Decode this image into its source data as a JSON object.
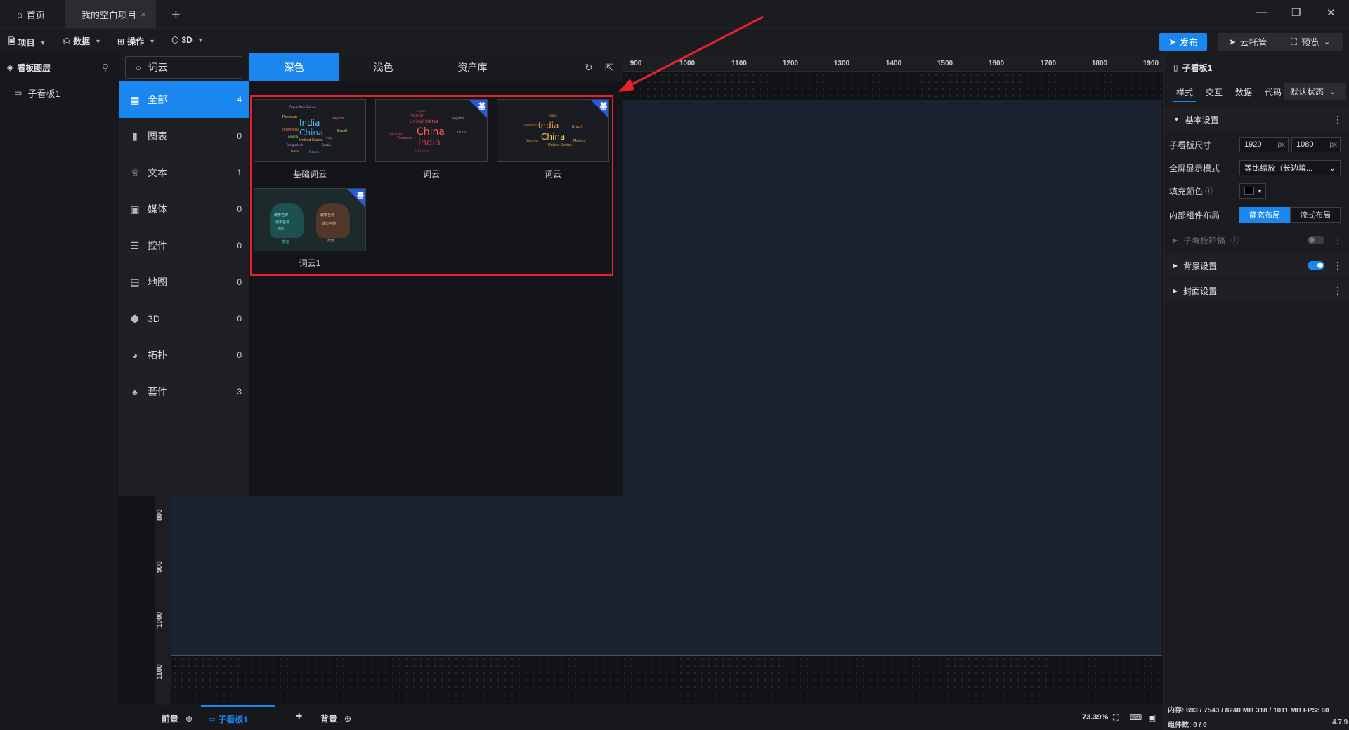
{
  "tabs": {
    "home_label": "首页",
    "project_label": "我的空白项目",
    "close_glyph": "×",
    "add_glyph": "+"
  },
  "window_controls": {
    "minimize": "—",
    "restore": "❐",
    "close": "✕"
  },
  "toolbar": {
    "menus": [
      {
        "label": "项目",
        "icon": "file-icon"
      },
      {
        "label": "数据",
        "icon": "database-icon"
      },
      {
        "label": "操作",
        "icon": "grid-icon"
      },
      {
        "label": "3D",
        "icon": "cube-icon"
      }
    ],
    "publish_label": "发布",
    "cloud_label": "云托管",
    "preview_label": "预览"
  },
  "layers": {
    "title": "看板图层",
    "items": [
      {
        "label": "子看板1"
      }
    ]
  },
  "component_panel": {
    "search_value": "词云",
    "categories": [
      {
        "label": "全部",
        "count": "4",
        "icon": "grid-icon"
      },
      {
        "label": "图表",
        "count": "0",
        "icon": "bar-chart-icon"
      },
      {
        "label": "文本",
        "count": "1",
        "icon": "text-icon"
      },
      {
        "label": "媒体",
        "count": "0",
        "icon": "media-icon"
      },
      {
        "label": "控件",
        "count": "0",
        "icon": "control-icon"
      },
      {
        "label": "地图",
        "count": "0",
        "icon": "map-icon"
      },
      {
        "label": "3D",
        "count": "0",
        "icon": "cube-icon"
      },
      {
        "label": "拓扑",
        "count": "0",
        "icon": "topology-icon"
      },
      {
        "label": "套件",
        "count": "3",
        "icon": "kit-icon"
      }
    ],
    "theme_tabs": [
      {
        "label": "深色"
      },
      {
        "label": "浅色"
      },
      {
        "label": "资产库"
      }
    ],
    "cards": [
      {
        "label": "基础词云",
        "badge": ""
      },
      {
        "label": "词云",
        "badge": "基"
      },
      {
        "label": "词云",
        "badge": "基"
      },
      {
        "label": "词云1",
        "badge": "基"
      }
    ],
    "thumb_words": {
      "a": [
        "Papua New Guinea",
        "India",
        "China",
        "United States",
        "Indonesia",
        "Brazil",
        "Pakistan",
        "Nigeria",
        "Bangladesh",
        "Russia",
        "Japan",
        "Mexico",
        "Algeria",
        "Iraq"
      ],
      "b": [
        "Pakistan",
        "United States",
        "China",
        "India",
        "Nigeria",
        "Brazil",
        "Canada",
        "Tanzania",
        "Ukraine",
        "Algeria"
      ],
      "c": [
        "India",
        "China",
        "United States",
        "Pakistan",
        "Brazil",
        "Nigeria",
        "Mexico",
        "Japan"
      ],
      "d_left": [
        "城市名称",
        "城市名称",
        "数据",
        "数值"
      ],
      "d_right": [
        "城市名称",
        "城市名称",
        "数值"
      ]
    }
  },
  "ruler": {
    "top": [
      "900",
      "1000",
      "1100",
      "1200",
      "1300",
      "1400",
      "1500",
      "1600",
      "1700",
      "1800",
      "1900"
    ],
    "left": [
      "800",
      "900",
      "1000",
      "1100"
    ]
  },
  "props": {
    "title": "子看板1",
    "tabs": [
      "样式",
      "交互",
      "数据",
      "代码"
    ],
    "state": "默认状态",
    "basic_section": "基本设置",
    "size_label": "子看板尺寸",
    "width": "1920",
    "height": "1080",
    "unit": "px",
    "fullscreen_label": "全屏显示模式",
    "fullscreen_value": "等比缩放（长边填...",
    "fill_label": "填充颜色",
    "layout_label": "内部组件布局",
    "layout_static": "静态布局",
    "layout_flow": "流式布局",
    "carousel_section": "子看板轮播",
    "bg_section": "背景设置",
    "cover_section": "封面设置"
  },
  "bottom": {
    "foreground": "前景",
    "board_tab": "子看板1",
    "background": "背景",
    "zoom": "73.39%",
    "memory": "内存:  693 / 7543 / 8240 MB  318 / 1011 MB FPS:  60",
    "components": "组件数: 0 / 0",
    "version": "4.7.9"
  },
  "colors": {
    "accent": "#1a86f0",
    "highlight_border": "#e8222c",
    "badge": "#2a5bd7",
    "arrow": "#e8222c"
  }
}
